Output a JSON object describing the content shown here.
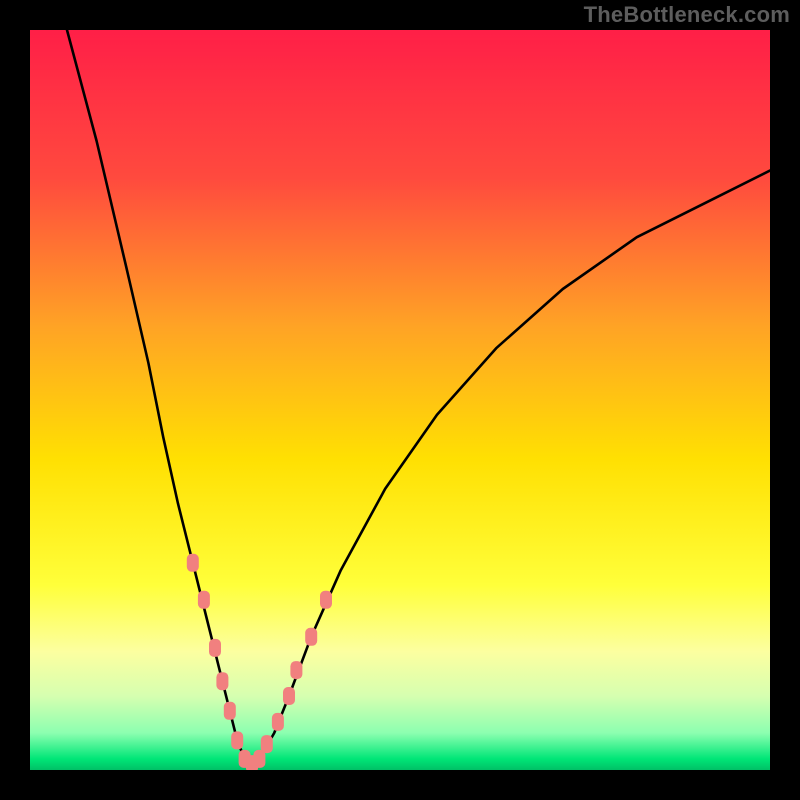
{
  "watermark": "TheBottleneck.com",
  "chart_data": {
    "type": "line",
    "title": "",
    "xlabel": "",
    "ylabel": "",
    "xlim": [
      0,
      100
    ],
    "ylim": [
      0,
      100
    ],
    "gradient_stops": [
      {
        "offset": 0.0,
        "color": "#ff1f47"
      },
      {
        "offset": 0.2,
        "color": "#ff4a3e"
      },
      {
        "offset": 0.4,
        "color": "#ffa325"
      },
      {
        "offset": 0.58,
        "color": "#ffe002"
      },
      {
        "offset": 0.75,
        "color": "#ffff3a"
      },
      {
        "offset": 0.84,
        "color": "#fcffa0"
      },
      {
        "offset": 0.9,
        "color": "#d6ffb0"
      },
      {
        "offset": 0.95,
        "color": "#8cffb0"
      },
      {
        "offset": 0.985,
        "color": "#00e677"
      },
      {
        "offset": 1.0,
        "color": "#00c066"
      }
    ],
    "series": [
      {
        "name": "bottleneck-curve",
        "type": "line",
        "x": [
          5,
          9,
          13,
          16,
          18,
          20,
          22,
          24,
          25.5,
          27,
          28,
          29,
          30,
          31,
          33,
          35,
          38,
          42,
          48,
          55,
          63,
          72,
          82,
          92,
          100
        ],
        "y": [
          100,
          85,
          68,
          55,
          45,
          36,
          28,
          20,
          14,
          8,
          4,
          1.5,
          0.8,
          1.5,
          5,
          10,
          18,
          27,
          38,
          48,
          57,
          65,
          72,
          77,
          81
        ]
      },
      {
        "name": "curve-markers",
        "type": "scatter",
        "x": [
          22,
          23.5,
          25,
          26,
          27,
          28,
          29,
          30,
          31,
          32,
          33.5,
          35,
          36,
          38,
          40
        ],
        "y": [
          28,
          23,
          16.5,
          12,
          8,
          4,
          1.5,
          0.8,
          1.5,
          3.5,
          6.5,
          10,
          13.5,
          18,
          23
        ]
      }
    ],
    "colors": {
      "curve_stroke": "#000000",
      "marker_fill": "#f1807f",
      "marker_stroke": "#e46969",
      "frame": "#000000"
    }
  }
}
